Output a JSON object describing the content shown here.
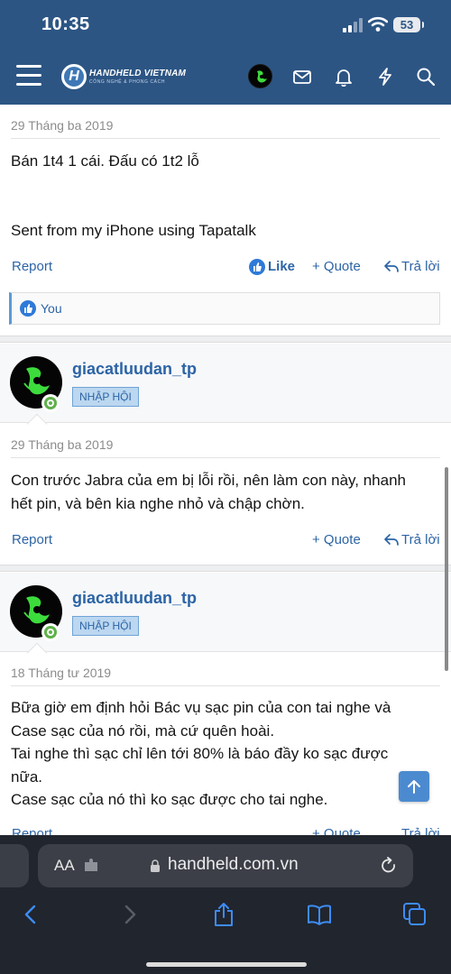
{
  "status_bar": {
    "time": "10:35",
    "battery": "53"
  },
  "header": {
    "logo_mark": "H",
    "logo_title": "HANDHELD VIETNAM",
    "logo_subtitle": "CÔNG NGHỆ & PHONG CÁCH",
    "icons": [
      "menu-icon",
      "razer-avatar",
      "envelope-icon",
      "bell-icon",
      "bolt-icon",
      "search-icon"
    ]
  },
  "posts": [
    {
      "date": "29 Tháng ba 2019",
      "body": [
        "Bán 1t4 1 cái. Đấu có 1t2 lỗ",
        "",
        "",
        "Sent from my iPhone using Tapatalk"
      ],
      "actions": {
        "report": "Report",
        "like": "Like",
        "quote": "+ Quote",
        "reply": "Trả lời"
      },
      "reactions": "You"
    },
    {
      "username": "giacatluudan_tp",
      "role": "NHẬP HỘI",
      "date": "29 Tháng ba 2019",
      "body": [
        "Con trước Jabra của em bị lỗi rồi, nên làm con này, nhanh",
        "hết pin, và bên kia nghe nhỏ và chập chờn."
      ],
      "actions": {
        "report": "Report",
        "quote": "+ Quote",
        "reply": "Trả lời"
      }
    },
    {
      "username": "giacatluudan_tp",
      "role": "NHẬP HỘI",
      "date": "18 Tháng tư 2019",
      "body": [
        "Bữa giờ em định hỏi Bác vụ sạc pin của con tai nghe và",
        "Case sạc của nó rồi, mà cứ quên hoài.",
        "Tai nghe thì sạc chỉ lên tới 80% là báo đầy ko sạc được",
        "nữa.",
        "Case sạc của nó thì ko sạc được cho tai nghe."
      ],
      "actions": {
        "report": "Report",
        "quote": "+ Quote",
        "reply": "Trả lời"
      }
    }
  ],
  "browser": {
    "text_size_label": "AA",
    "url": "handheld.com.vn",
    "toolbar_icons": [
      "back-icon",
      "forward-icon",
      "share-icon",
      "bookmarks-icon",
      "tabs-icon"
    ]
  },
  "colors": {
    "header_bg": "#2c5584",
    "link": "#2c64a5",
    "badge_bg": "#bcd7f0",
    "online": "#5fb24a",
    "safari_bg": "#21252d"
  }
}
